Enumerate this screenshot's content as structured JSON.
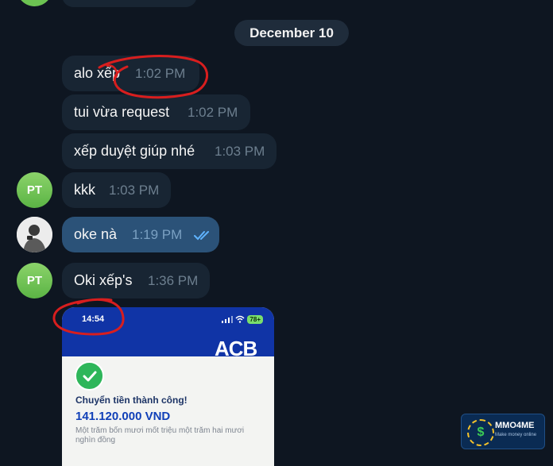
{
  "date_separator": "December 10",
  "messages": [
    {
      "text": "alo xếp",
      "time": "1:02 PM"
    },
    {
      "text": "tui vừa request",
      "time": "1:02 PM"
    },
    {
      "text": "xếp duyệt giúp nhé",
      "time": "1:03 PM"
    },
    {
      "text": "kkk",
      "time": "1:03 PM",
      "avatar": "PT"
    },
    {
      "text": "oke nà",
      "time": "1:19 PM"
    },
    {
      "text": "Oki xếp's",
      "time": "1:36 PM",
      "avatar": "PT"
    }
  ],
  "receipt": {
    "phone_time": "14:54",
    "battery": "78+",
    "bank_logo": "ACB",
    "title": "Chuyển tiền thành công!",
    "amount": "141.120.000 VND",
    "amount_words": "Một trăm bốn mươi mốt triệu một trăm hai mươi nghìn đồng"
  },
  "watermark": {
    "brand": "MMO4ME",
    "tagline": "Make money online"
  },
  "colors": {
    "background": "#0e1621",
    "incoming_bubble": "#182533",
    "outgoing_bubble": "#2b5278",
    "avatar_green": "#6cc352",
    "read_ticks": "#5fb3ff",
    "annotation_red": "#d81e1e"
  }
}
